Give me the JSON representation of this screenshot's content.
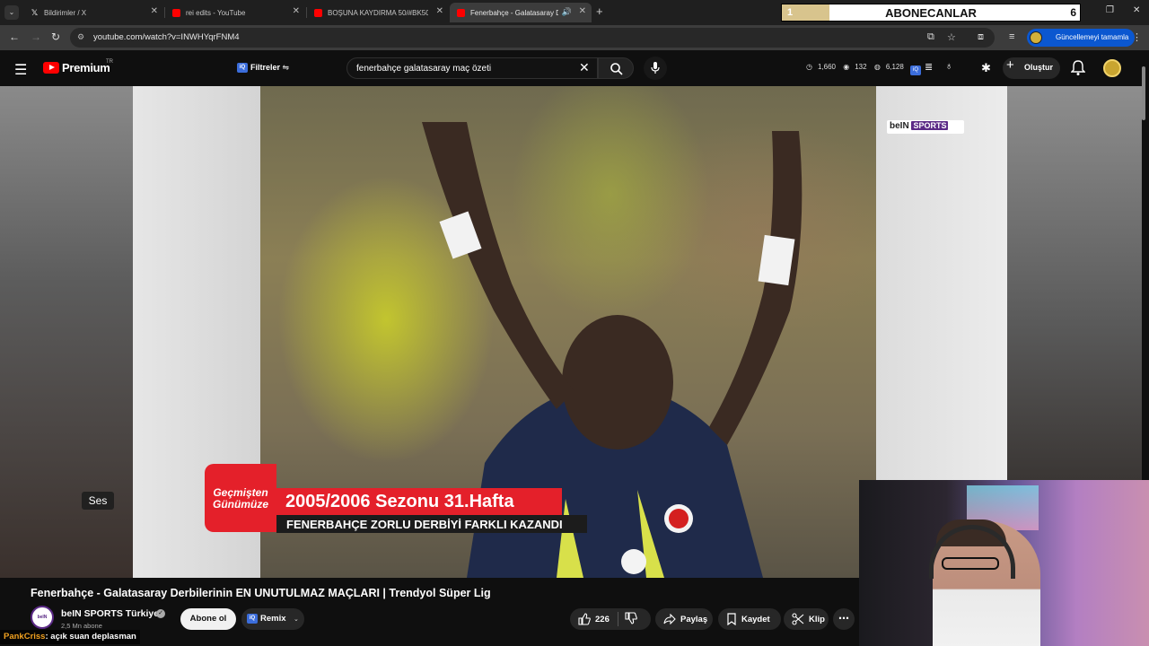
{
  "browser": {
    "tabs": [
      {
        "title": "Bildirimler / X",
        "favicon": "x-icon"
      },
      {
        "title": "rei edits - YouTube",
        "favicon": "youtube-icon"
      },
      {
        "title": "BOŞUNA KAYDIRMA 50/#BK50",
        "favicon": "youtube-icon"
      },
      {
        "title": "Fenerbahçe - Galatasaray D",
        "favicon": "youtube-icon",
        "active": true
      }
    ],
    "url": "youtube.com/watch?v=INWHYqrFNM4",
    "update_label": "Güncellemeyi tamamla"
  },
  "subscriber_overlay": {
    "left_value": "1",
    "title": "ABONECANLAR",
    "right_value": "6",
    "progress": 0.16
  },
  "youtube": {
    "brand": "Premium",
    "region": "TR",
    "filters_label": "Filtreler",
    "search_query": "fenerbahçe galatasaray maç özeti",
    "stats": {
      "views": "1,660",
      "eye": "132",
      "other": "6,128"
    },
    "create_label": "Oluştur"
  },
  "video": {
    "overlay_logo_text": "beIN",
    "overlay_logo_sports": "SPORTS",
    "lower_third_tag": "Geçmişten Günümüze",
    "lower_third_line1": "2005/2006 Sezonu 31.Hafta",
    "lower_third_line2": "FENERBAHÇE ZORLU DERBİYİ FARKLI KAZANDI",
    "tooltip": "Ses",
    "title": "Fenerbahçe - Galatasaray Derbilerinin EN UNUTULMAZ MAÇLARI | Trendyol Süper Lig"
  },
  "channel": {
    "name": "beIN SPORTS Türkiye",
    "subscribers": "2,5 Mn abone",
    "subscribe_label": "Abone ol",
    "remix_label": "Remix"
  },
  "actions": {
    "likes": "226",
    "share_label": "Paylaş",
    "save_label": "Kaydet",
    "clip_label": "Klip"
  },
  "chat": {
    "user": "PankCriss",
    "message": ": açık suan deplasman"
  },
  "colors": {
    "youtube_red": "#ff0000",
    "lower_third_red": "#e4202a",
    "accent_blue": "#0b57d0",
    "bein_purple": "#5b2a86"
  }
}
